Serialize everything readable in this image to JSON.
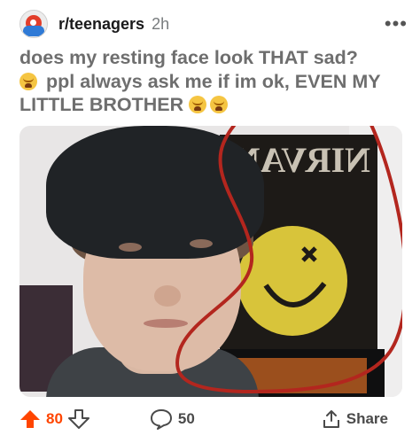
{
  "post": {
    "subreddit": "r/teenagers",
    "age": "2h",
    "more_icon": "more-horizontal-icon",
    "title_text": "does my resting face look THAT sad?",
    "title_text_2": "ppl always ask me if im ok, EVEN MY LITTLE BROTHER",
    "title_emojis": [
      "crying-face-icon",
      "crying-face-icon",
      "crying-face-icon"
    ]
  },
  "image": {
    "poster_text": "NIRVANA",
    "annotation_color": "#b3261e"
  },
  "actions": {
    "upvotes": "80",
    "comments": "50",
    "share_label": "Share",
    "upvote_color": "#ff4500"
  }
}
